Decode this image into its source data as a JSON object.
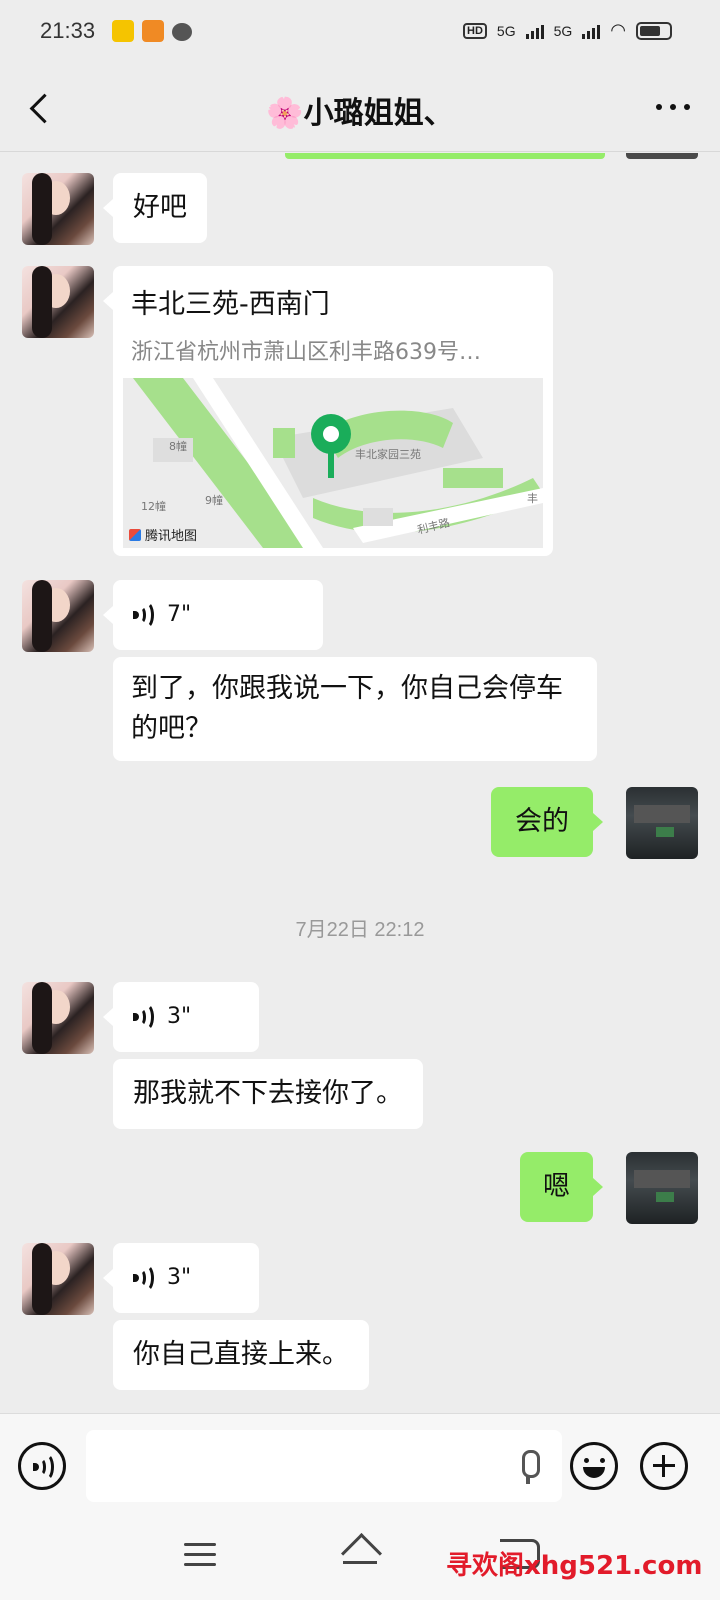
{
  "status_bar": {
    "time": "21:33",
    "hd": "HD",
    "network1": "5G",
    "network2": "5G",
    "icons": [
      "app-icon-1",
      "app-icon-2",
      "message-icon",
      "signal-icon",
      "wifi-icon",
      "battery-icon"
    ]
  },
  "header": {
    "title": "🌸小璐姐姐、"
  },
  "messages": {
    "m1": "好吧",
    "location": {
      "title": "丰北三苑-西南门",
      "address": "浙江省杭州市萧山区利丰路639号…",
      "map_credit": "腾讯地图",
      "map_labels": [
        "丰北家园三苑",
        "利丰路",
        "8幢",
        "9幢",
        "12幢",
        "丰"
      ]
    },
    "voice1": "7\"",
    "m2": "到了，你跟我说一下，你自己会停车的吧？",
    "m3": "会的",
    "timestamp": "7月22日 22:12",
    "voice2": "3\"",
    "m4": "那我就不下去接你了。",
    "m5": "嗯",
    "voice3": "3\"",
    "m6": "你自己直接上来。"
  },
  "watermark": "寻欢阁xhg521.com",
  "colors": {
    "background": "#ededed",
    "my_bubble": "#95ec69",
    "their_bubble": "#ffffff",
    "map_pin": "#1aad5a",
    "watermark": "#e21b2a"
  }
}
